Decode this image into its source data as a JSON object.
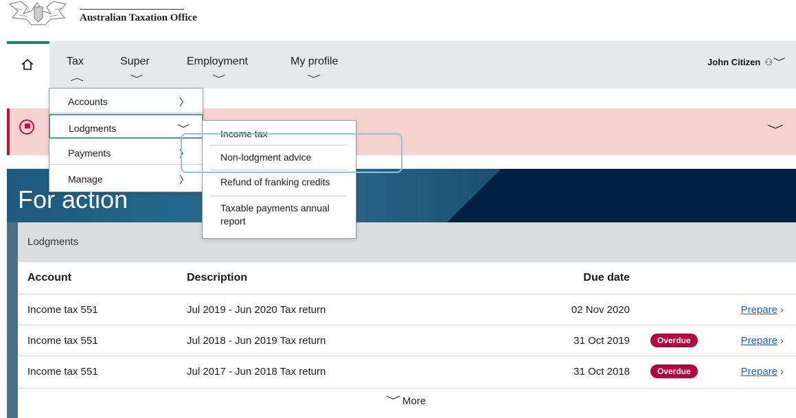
{
  "header": {
    "brand": "Australian Taxation Office",
    "crest": "Commonwealth coat of arms"
  },
  "nav": {
    "home_icon": "home-icon",
    "items": [
      {
        "label": "Tax"
      },
      {
        "label": "Super"
      },
      {
        "label": "Employment"
      },
      {
        "label": "My profile"
      }
    ],
    "user": "John Citizen"
  },
  "tax_menu": {
    "items": [
      {
        "label": "Accounts"
      },
      {
        "label": "Lodgments"
      },
      {
        "label": "Payments"
      },
      {
        "label": "Manage"
      }
    ]
  },
  "lodgments_menu": {
    "items": [
      {
        "label": "Income tax"
      },
      {
        "label": "Non-lodgment advice"
      },
      {
        "label": "Refund of franking credits"
      },
      {
        "label": "Taxable payments annual report"
      }
    ]
  },
  "banner": {
    "title": "For action"
  },
  "lodgments_card": {
    "heading": "Lodgments",
    "columns": {
      "account": "Account",
      "description": "Description",
      "due": "Due date"
    },
    "rows": [
      {
        "account": "Income tax 551",
        "description": "Jul 2019 - Jun 2020 Tax return",
        "due": "02 Nov 2020",
        "status": "",
        "action": "Prepare"
      },
      {
        "account": "Income tax 551",
        "description": "Jul 2018 - Jun 2019 Tax return",
        "due": "31 Oct 2019",
        "status": "Overdue",
        "action": "Prepare"
      },
      {
        "account": "Income tax 551",
        "description": "Jul 2017 - Jun 2018 Tax return",
        "due": "31 Oct 2018",
        "status": "Overdue",
        "action": "Prepare"
      }
    ],
    "more": "More"
  },
  "colors": {
    "accent_teal": "#16807a",
    "alert_red": "#c0103b",
    "alert_bg": "#f5d2cf",
    "banner_navy": "#002142",
    "badge_red": "#b5023c",
    "link_blue": "#1a5fc7"
  }
}
